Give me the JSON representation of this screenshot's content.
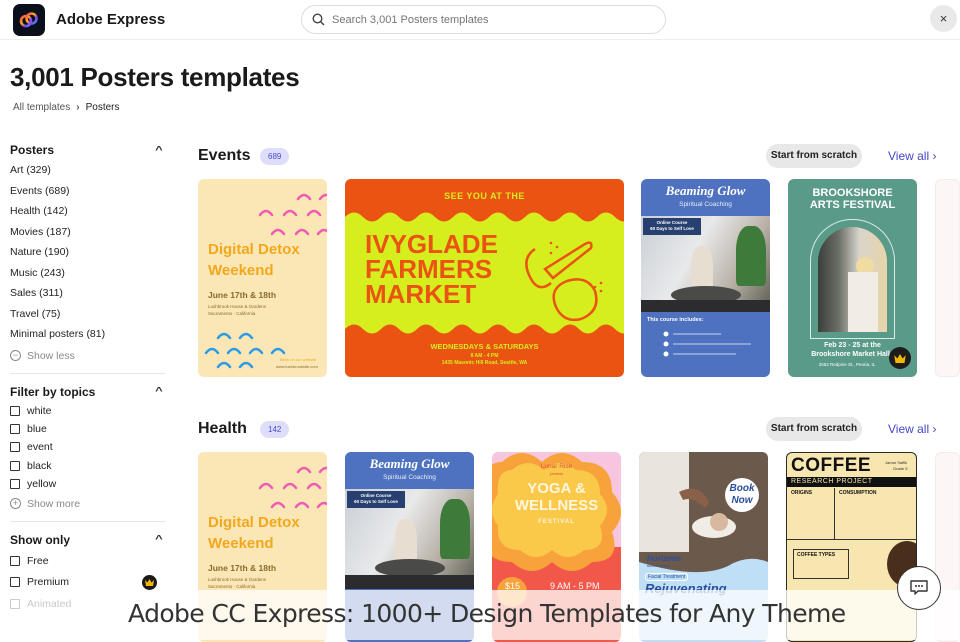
{
  "header": {
    "brand": "Adobe Express",
    "search_placeholder": "Search 3,001 Posters templates",
    "close_label": "×"
  },
  "page": {
    "title": "3,001 Posters templates",
    "breadcrumb": [
      {
        "label": "All templates"
      },
      {
        "label": "Posters"
      }
    ],
    "breadcrumb_sep": "›"
  },
  "sidebar": {
    "posters": {
      "heading": "Posters",
      "items": [
        {
          "label": "Art (329)"
        },
        {
          "label": "Events (689)"
        },
        {
          "label": "Health (142)"
        },
        {
          "label": "Movies (187)"
        },
        {
          "label": "Nature (190)"
        },
        {
          "label": "Music (243)"
        },
        {
          "label": "Sales (311)"
        },
        {
          "label": "Travel (75)"
        },
        {
          "label": "Minimal posters (81)"
        }
      ],
      "toggle": "Show less"
    },
    "topics": {
      "heading": "Filter by topics",
      "items": [
        {
          "label": "white",
          "checked": false
        },
        {
          "label": "blue",
          "checked": false
        },
        {
          "label": "event",
          "checked": false
        },
        {
          "label": "black",
          "checked": false
        },
        {
          "label": "yellow",
          "checked": false
        }
      ],
      "toggle": "Show more"
    },
    "show_only": {
      "heading": "Show only",
      "items": [
        {
          "label": "Free",
          "checked": false
        },
        {
          "label": "Premium",
          "checked": false
        },
        {
          "label": "Animated",
          "checked": false
        }
      ]
    }
  },
  "sections": [
    {
      "title": "Events",
      "count": "689",
      "scratch_label": "Start from scratch",
      "view_all": "View all",
      "cards": [
        {
          "name": "Digital Detox Weekend",
          "l1": "Digital Detox",
          "l2": "Weekend",
          "date": "June 17th & 18th",
          "venue1": "Lushbrook House & Gardens",
          "venue2": "Sacramento · California",
          "book": "Book on our website",
          "site": "www.lushbrooksite.com"
        },
        {
          "name": "Ivyglade Farmers Market",
          "top": "SEE YOU AT THE",
          "l1": "IVYGLADE",
          "l2": "FARMERS",
          "l3": "MARKET",
          "days": "WEDNESDAYS & SATURDAYS",
          "time": "8 AM - 4 PM",
          "addr": "1435 Masonic Hill Road, Seattle, WA"
        },
        {
          "name": "Beaming Glow",
          "title": "Beaming Glow",
          "sub": "Spiritual Coaching",
          "course1": "Online Course",
          "course2": "60 Days to Self Love",
          "includes": "This course includes:"
        },
        {
          "name": "Brookshore Arts Festival",
          "l1": "BROOKSHORE",
          "l2": "ARTS FESTIVAL",
          "d1": "Feb 23 - 25 at the",
          "d2": "Brookshore Market Hall",
          "addr": "2552 Redpine St., Peoria, IL",
          "premium": true
        }
      ]
    },
    {
      "title": "Health",
      "count": "142",
      "scratch_label": "Start from scratch",
      "view_all": "View all",
      "cards": [
        {
          "name": "Digital Detox Weekend",
          "l1": "Digital Detox",
          "l2": "Weekend",
          "date": "June 17th & 18th",
          "venue1": "Lushbrook House & Gardens",
          "venue2": "Sacramento · California"
        },
        {
          "name": "Beaming Glow",
          "title": "Beaming Glow",
          "sub": "Spiritual Coaching",
          "course1": "Online Course",
          "course2": "60 Days to Self Love"
        },
        {
          "name": "Yoga & Wellness Festival",
          "org": "Lunar Rise",
          "presents": "presents",
          "l1": "YOGA &",
          "l2": "WELLNESS",
          "l3": "FESTIVAL",
          "price": "$15",
          "time": "9 AM - 5 PM"
        },
        {
          "name": "Horizons Beauty Salon",
          "book1": "Book",
          "book2": "Now",
          "brand": "Horizons",
          "brand_sub": "BEAUTY SALON",
          "tag": "Facial Treatment",
          "headline": "Rejuvenating"
        },
        {
          "name": "Coffee Research Project",
          "title": "COFFEE",
          "author1": "Jamar Saffik",
          "author2": "Grade 5",
          "sub": "RESEARCH PROJECT",
          "s1": "ORIGINS",
          "s2": "CONSUMPTION",
          "s3": "COFFEE TYPES"
        }
      ]
    }
  ],
  "caption": "Adobe CC Express: 1000+ Design Templates for Any Theme",
  "colors": {
    "accent": "#4646c8",
    "badge_bg": "#dedefa"
  }
}
